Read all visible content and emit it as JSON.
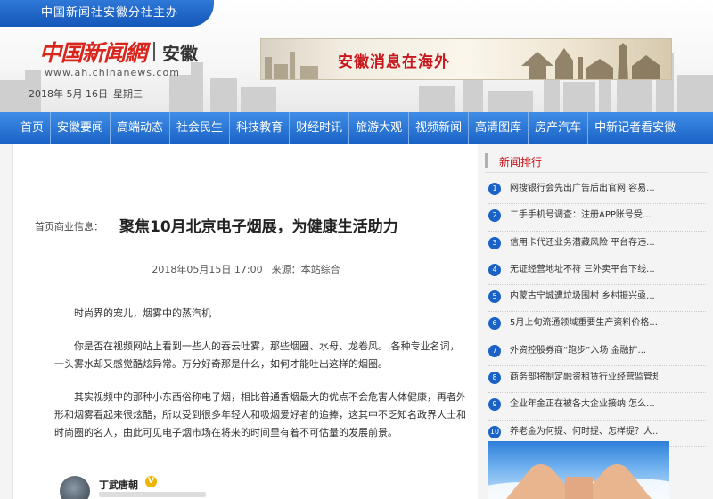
{
  "header": {
    "banner": "中国新闻社安徽分社主办",
    "logo_cn": "中国新闻網",
    "logo_region": "安徽",
    "logo_url": "www.ah.chinanews.com",
    "date": "2018年 5月 16日",
    "weekday": "星期三",
    "ad_text": "安徽消息在海外"
  },
  "nav": {
    "items": [
      "首页",
      "安徽要闻",
      "高端动态",
      "社会民生",
      "科技教育",
      "财经时讯",
      "旅游大观",
      "视频新闻",
      "高清图库",
      "房产汽车",
      "中新记者看安徽"
    ]
  },
  "article": {
    "label": "首页商业信息：",
    "title": "聚焦10月北京电子烟展，为健康生活助力",
    "datetime": "2018年05月15日 17:00",
    "source": "来源：本站综合",
    "paragraphs": [
      "时尚界的宠儿，烟雾中的蒸汽机",
      "你是否在视频网站上看到一些人的吞云吐雾，那些烟圈、水母、龙卷风。.各种专业名词，一头雾水却又感觉酷炫异常。万分好奇那是什么，如何才能吐出这样的烟圈。",
      "其实视频中的那种小东西俗称电子烟，相比普通香烟最大的优点不会危害人体健康，再者外形和烟雾看起来很炫酷，所以受到很多年轻人和吸烟爱好者的追捧，这其中不乏知名政界人士和时尚圈的名人，由此可见电子烟市场在将来的时间里有着不可估量的发展前景。"
    ],
    "author": "丁武唐朝",
    "author_badge": "V"
  },
  "sidebar": {
    "title": "新闻排行",
    "items": [
      {
        "num": "1",
        "text": "网搜银行会先出广告后出官网 容易..."
      },
      {
        "num": "2",
        "text": "二手手机号调查：注册APP账号受..."
      },
      {
        "num": "3",
        "text": "信用卡代还业务潜藏风险 平台存违..."
      },
      {
        "num": "4",
        "text": "无证经营地址不符 三外卖平台下线..."
      },
      {
        "num": "5",
        "text": "内蒙古宁城遭垃圾围村 乡村振兴亟..."
      },
      {
        "num": "6",
        "text": "5月上旬流通领域重要生产资料价格..."
      },
      {
        "num": "7",
        "text": "外资控股券商“跑步”入场 金融扩..."
      },
      {
        "num": "8",
        "text": "商务部将制定融资租赁行业经营监管规..."
      },
      {
        "num": "9",
        "text": "企业年金正在被各大企业接纳 怎么..."
      },
      {
        "num": "10",
        "text": "养老金为何提、何时提、怎样提？人..."
      }
    ]
  },
  "colors": {
    "nav_blue": "#1a62c6",
    "brand_red": "#c8161d"
  }
}
